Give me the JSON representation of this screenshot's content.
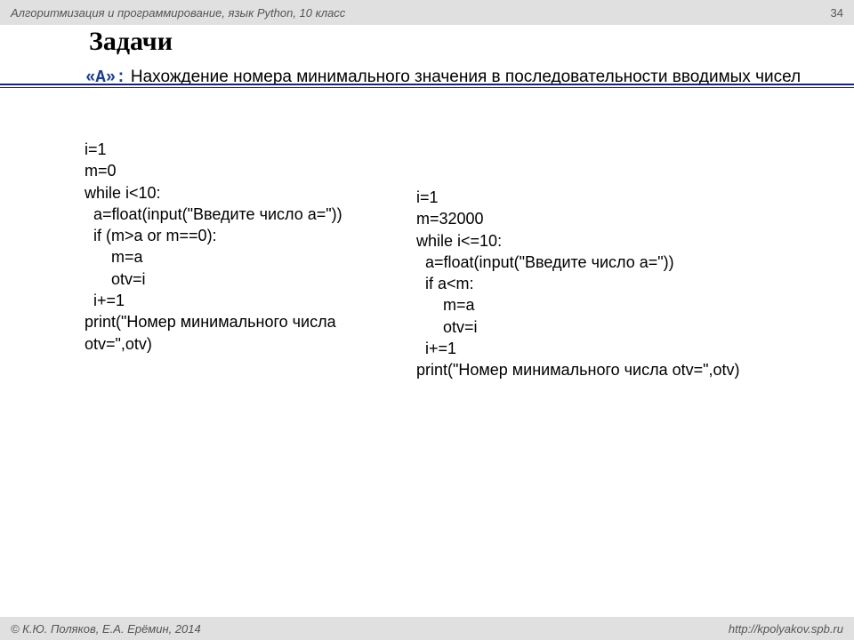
{
  "header": {
    "title": "Алгоритмизация и программирование, язык Python, 10 класс",
    "page_number": "34"
  },
  "slide": {
    "title": "Задачи",
    "subtitle_label": "«A»:",
    "subtitle_text": " Нахождение номера минимального значения в последовательности вводимых чисел"
  },
  "code": {
    "left": "i=1\nm=0\nwhile i<10:\n  a=float(input(\"Введите число a=\"))\n  if (m>a or m==0):\n      m=a\n      otv=i\n  i+=1\nprint(\"Номер минимального числа otv=\",otv)",
    "right": "i=1\nm=32000\nwhile i<=10:\n  a=float(input(\"Введите число a=\"))\n  if a<m:\n      m=a\n      otv=i\n  i+=1\nprint(\"Номер минимального числа otv=\",otv)"
  },
  "footer": {
    "left": "© К.Ю. Поляков, Е.А. Ерёмин, 2014",
    "right": "http://kpolyakov.spb.ru"
  }
}
